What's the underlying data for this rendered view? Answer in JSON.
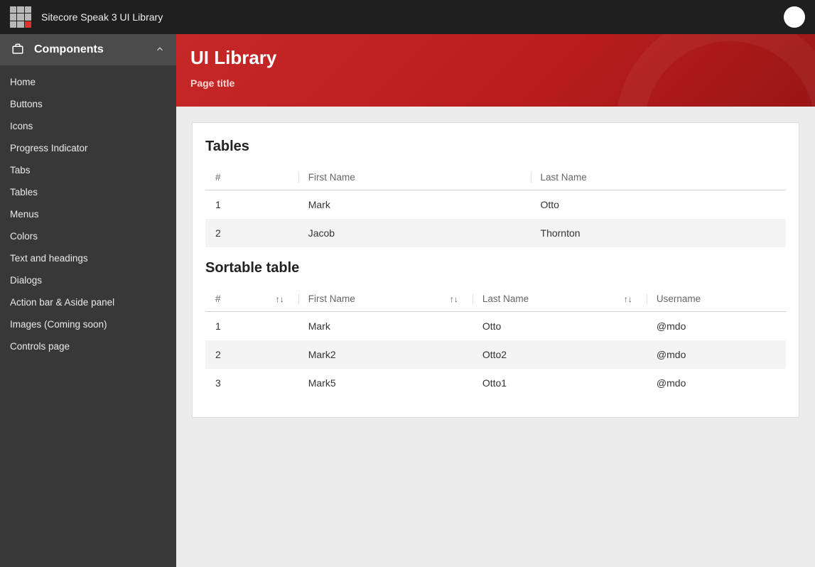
{
  "app": {
    "title": "Sitecore Speak 3 UI Library"
  },
  "sidebar": {
    "header": "Components",
    "items": [
      {
        "label": "Home"
      },
      {
        "label": "Buttons"
      },
      {
        "label": "Icons"
      },
      {
        "label": "Progress Indicator"
      },
      {
        "label": "Tabs"
      },
      {
        "label": "Tables"
      },
      {
        "label": "Menus"
      },
      {
        "label": "Colors"
      },
      {
        "label": "Text and headings"
      },
      {
        "label": "Dialogs"
      },
      {
        "label": "Action bar & Aside panel"
      },
      {
        "label": "Images (Coming soon)"
      },
      {
        "label": "Controls page"
      }
    ]
  },
  "hero": {
    "title": "UI Library",
    "subtitle": "Page title"
  },
  "tables": {
    "basic": {
      "heading": "Tables",
      "columns": [
        "#",
        "First Name",
        "Last Name"
      ],
      "rows": [
        [
          "1",
          "Mark",
          "Otto"
        ],
        [
          "2",
          "Jacob",
          "Thornton"
        ]
      ]
    },
    "sortable": {
      "heading": "Sortable table",
      "columns": [
        "#",
        "First Name",
        "Last Name",
        "Username"
      ],
      "rows": [
        [
          "1",
          "Mark",
          "Otto",
          "@mdo"
        ],
        [
          "2",
          "Mark2",
          "Otto2",
          "@mdo"
        ],
        [
          "3",
          "Mark5",
          "Otto1",
          "@mdo"
        ]
      ]
    }
  }
}
